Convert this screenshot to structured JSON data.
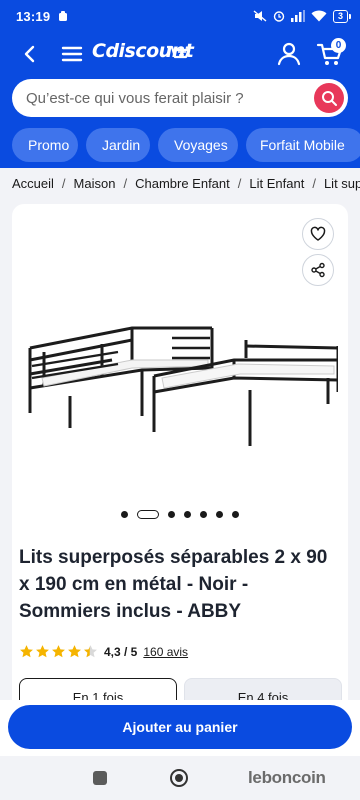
{
  "status_bar": {
    "time": "13:19",
    "battery": "3"
  },
  "header": {
    "logo_text": "Cdiscount",
    "cart_count": "0",
    "search": {
      "placeholder": "Qu’est-ce qui vous ferait plaisir ?"
    },
    "chips": [
      "Promo",
      "Jardin",
      "Voyages",
      "Forfait Mobile"
    ]
  },
  "breadcrumb": [
    "Accueil",
    "Maison",
    "Chambre Enfant",
    "Lit Enfant",
    "Lit sup"
  ],
  "product": {
    "title": "Lits superposés séparables 2 x 90 x 190 cm en métal - Noir - Sommiers inclus - ABBY",
    "rating": "4,3 / 5",
    "rating_value": 4.3,
    "reviews": "160 avis",
    "image_count": 7,
    "active_image": 1,
    "options": [
      "En 1 fois",
      "En 4 fois"
    ]
  },
  "cta": {
    "add_to_cart": "Ajouter au panier"
  },
  "watermark": "leboncoin",
  "colors": {
    "brand": "#0a4be0",
    "search_button": "#e8385a",
    "chip": "#3f74ec",
    "star": "#f5b400"
  }
}
